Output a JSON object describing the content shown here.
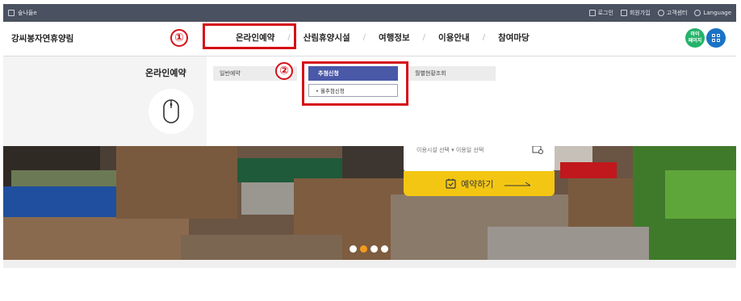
{
  "topbar": {
    "home_label": "숲나들e",
    "links": [
      "로그인",
      "회원가입",
      "고객센터",
      "Language"
    ]
  },
  "header": {
    "site_title": "강씨봉자연휴양림",
    "nav": [
      "온라인예약",
      "산림휴양시설",
      "여행정보",
      "이용안내",
      "참여마당"
    ],
    "mypage_label": "마이\n페이지",
    "annotation_1": "①",
    "annotation_2": "②"
  },
  "dropdown": {
    "title": "온라인예약",
    "items": [
      "일반예약",
      "추첨신청",
      "월별현황조회"
    ],
    "sub_item": "• 월추첨신청"
  },
  "hero": {
    "booking_text": "이용시설 선택  ▾  이용일 선택",
    "reserve_label": "예약하기",
    "slides": [
      false,
      true,
      false,
      false
    ]
  },
  "colors": {
    "accent_red": "#d60f16",
    "active_tab": "#4a58a8",
    "reserve_yellow": "#f3c613"
  }
}
